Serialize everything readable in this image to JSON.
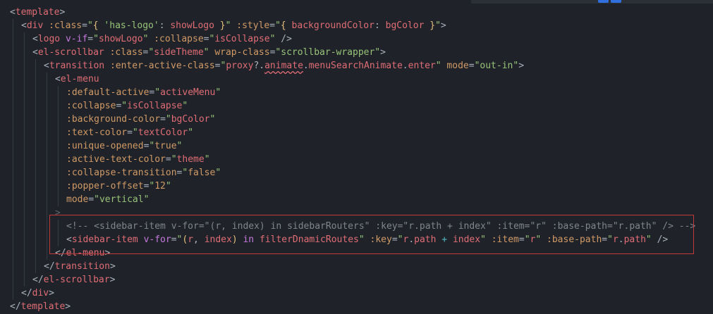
{
  "editor": {
    "language": "vue-template",
    "highlight_color": "#c0393b",
    "lines": [
      {
        "indent": 0,
        "tokens": [
          {
            "k": "punc",
            "t": "<"
          },
          {
            "k": "tag",
            "t": "template"
          },
          {
            "k": "punc",
            "t": ">"
          }
        ]
      },
      {
        "indent": 1,
        "tokens": [
          {
            "k": "punc",
            "t": "<"
          },
          {
            "k": "tag",
            "t": "div"
          },
          {
            "k": "punc",
            "t": " "
          },
          {
            "k": "attr",
            "t": ":class"
          },
          {
            "k": "punc",
            "t": "="
          },
          {
            "k": "str",
            "t": "\""
          },
          {
            "k": "brace",
            "t": "{"
          },
          {
            "k": "str",
            "t": " 'has-logo'"
          },
          {
            "k": "punc",
            "t": ": "
          },
          {
            "k": "var",
            "t": "showLogo"
          },
          {
            "k": "brace",
            "t": " }"
          },
          {
            "k": "str",
            "t": "\""
          },
          {
            "k": "punc",
            "t": " "
          },
          {
            "k": "attr",
            "t": ":style"
          },
          {
            "k": "punc",
            "t": "="
          },
          {
            "k": "str",
            "t": "\""
          },
          {
            "k": "brace",
            "t": "{"
          },
          {
            "k": "var",
            "t": " backgroundColor"
          },
          {
            "k": "punc",
            "t": ": "
          },
          {
            "k": "var",
            "t": "bgColor"
          },
          {
            "k": "brace",
            "t": " }"
          },
          {
            "k": "str",
            "t": "\""
          },
          {
            "k": "punc",
            "t": ">"
          }
        ]
      },
      {
        "indent": 2,
        "tokens": [
          {
            "k": "punc",
            "t": "<"
          },
          {
            "k": "tag",
            "t": "logo"
          },
          {
            "k": "punc",
            "t": " "
          },
          {
            "k": "kw",
            "t": "v-if"
          },
          {
            "k": "punc",
            "t": "="
          },
          {
            "k": "str",
            "t": "\""
          },
          {
            "k": "var",
            "t": "showLogo"
          },
          {
            "k": "str",
            "t": "\""
          },
          {
            "k": "punc",
            "t": " "
          },
          {
            "k": "attr",
            "t": ":collapse"
          },
          {
            "k": "punc",
            "t": "="
          },
          {
            "k": "str",
            "t": "\""
          },
          {
            "k": "var",
            "t": "isCollapse"
          },
          {
            "k": "str",
            "t": "\""
          },
          {
            "k": "punc",
            "t": " />"
          }
        ]
      },
      {
        "indent": 2,
        "tokens": [
          {
            "k": "punc",
            "t": "<"
          },
          {
            "k": "tag",
            "t": "el-scrollbar"
          },
          {
            "k": "punc",
            "t": " "
          },
          {
            "k": "attr",
            "t": ":class"
          },
          {
            "k": "punc",
            "t": "="
          },
          {
            "k": "str",
            "t": "\""
          },
          {
            "k": "var",
            "t": "sideTheme"
          },
          {
            "k": "str",
            "t": "\""
          },
          {
            "k": "punc",
            "t": " "
          },
          {
            "k": "attr",
            "t": "wrap-class"
          },
          {
            "k": "punc",
            "t": "="
          },
          {
            "k": "str",
            "t": "\"scrollbar-wrapper\""
          },
          {
            "k": "punc",
            "t": ">"
          }
        ]
      },
      {
        "indent": 3,
        "tokens": [
          {
            "k": "punc",
            "t": "<"
          },
          {
            "k": "tag",
            "t": "transition"
          },
          {
            "k": "punc",
            "t": " "
          },
          {
            "k": "attr",
            "t": ":enter-active-class"
          },
          {
            "k": "punc",
            "t": "="
          },
          {
            "k": "str",
            "t": "\""
          },
          {
            "k": "var",
            "t": "proxy"
          },
          {
            "k": "punc",
            "t": "?."
          },
          {
            "k": "sq",
            "t": "animate"
          },
          {
            "k": "punc",
            "t": "."
          },
          {
            "k": "var",
            "t": "menuSearchAnimate"
          },
          {
            "k": "punc",
            "t": "."
          },
          {
            "k": "var",
            "t": "enter"
          },
          {
            "k": "str",
            "t": "\""
          },
          {
            "k": "punc",
            "t": " "
          },
          {
            "k": "attr",
            "t": "mode"
          },
          {
            "k": "punc",
            "t": "="
          },
          {
            "k": "str",
            "t": "\"out-in\""
          },
          {
            "k": "punc",
            "t": ">"
          }
        ]
      },
      {
        "indent": 4,
        "tokens": [
          {
            "k": "punc",
            "t": "<"
          },
          {
            "k": "tag",
            "t": "el-menu"
          }
        ]
      },
      {
        "indent": 5,
        "tokens": [
          {
            "k": "attr",
            "t": ":default-active"
          },
          {
            "k": "punc",
            "t": "="
          },
          {
            "k": "str",
            "t": "\""
          },
          {
            "k": "var",
            "t": "activeMenu"
          },
          {
            "k": "str",
            "t": "\""
          }
        ]
      },
      {
        "indent": 5,
        "tokens": [
          {
            "k": "attr",
            "t": ":collapse"
          },
          {
            "k": "punc",
            "t": "="
          },
          {
            "k": "str",
            "t": "\""
          },
          {
            "k": "var",
            "t": "isCollapse"
          },
          {
            "k": "str",
            "t": "\""
          }
        ]
      },
      {
        "indent": 5,
        "tokens": [
          {
            "k": "attr",
            "t": ":background-color"
          },
          {
            "k": "punc",
            "t": "="
          },
          {
            "k": "str",
            "t": "\""
          },
          {
            "k": "var",
            "t": "bgColor"
          },
          {
            "k": "str",
            "t": "\""
          }
        ]
      },
      {
        "indent": 5,
        "tokens": [
          {
            "k": "attr",
            "t": ":text-color"
          },
          {
            "k": "punc",
            "t": "="
          },
          {
            "k": "str",
            "t": "\""
          },
          {
            "k": "var",
            "t": "textColor"
          },
          {
            "k": "str",
            "t": "\""
          }
        ]
      },
      {
        "indent": 5,
        "tokens": [
          {
            "k": "attr",
            "t": ":unique-opened"
          },
          {
            "k": "punc",
            "t": "="
          },
          {
            "k": "str",
            "t": "\""
          },
          {
            "k": "attr",
            "t": "true"
          },
          {
            "k": "str",
            "t": "\""
          }
        ]
      },
      {
        "indent": 5,
        "tokens": [
          {
            "k": "attr",
            "t": ":active-text-color"
          },
          {
            "k": "punc",
            "t": "="
          },
          {
            "k": "str",
            "t": "\""
          },
          {
            "k": "var",
            "t": "theme"
          },
          {
            "k": "str",
            "t": "\""
          }
        ]
      },
      {
        "indent": 5,
        "tokens": [
          {
            "k": "attr",
            "t": ":collapse-transition"
          },
          {
            "k": "punc",
            "t": "="
          },
          {
            "k": "str",
            "t": "\""
          },
          {
            "k": "attr",
            "t": "false"
          },
          {
            "k": "str",
            "t": "\""
          }
        ]
      },
      {
        "indent": 5,
        "tokens": [
          {
            "k": "attr",
            "t": ":popper-offset"
          },
          {
            "k": "punc",
            "t": "="
          },
          {
            "k": "str",
            "t": "\""
          },
          {
            "k": "attr",
            "t": "12"
          },
          {
            "k": "str",
            "t": "\""
          }
        ]
      },
      {
        "indent": 5,
        "tokens": [
          {
            "k": "attr",
            "t": "mode"
          },
          {
            "k": "punc",
            "t": "="
          },
          {
            "k": "str",
            "t": "\"vertical\""
          }
        ]
      },
      {
        "indent": 4,
        "tokens": [
          {
            "k": "dim",
            "t": ">"
          }
        ]
      },
      {
        "indent": 5,
        "tokens": [
          {
            "k": "comment",
            "t": "<!-- <sidebar-item v-for=\"(r, index) in sidebarRouters\" :key=\"r.path + index\" :item=\"r\" :base-path=\"r.path\" /> -->"
          }
        ]
      },
      {
        "indent": 5,
        "tokens": [
          {
            "k": "punc",
            "t": "<"
          },
          {
            "k": "tag",
            "t": "sidebar-item"
          },
          {
            "k": "punc",
            "t": " "
          },
          {
            "k": "kw",
            "t": "v-for"
          },
          {
            "k": "punc",
            "t": "="
          },
          {
            "k": "str",
            "t": "\""
          },
          {
            "k": "brace",
            "t": "("
          },
          {
            "k": "var",
            "t": "r"
          },
          {
            "k": "punc",
            "t": ", "
          },
          {
            "k": "var",
            "t": "index"
          },
          {
            "k": "brace",
            "t": ")"
          },
          {
            "k": "punc",
            "t": " "
          },
          {
            "k": "kw",
            "t": "in"
          },
          {
            "k": "punc",
            "t": " "
          },
          {
            "k": "var",
            "t": "filterDnamicRoutes"
          },
          {
            "k": "str",
            "t": "\""
          },
          {
            "k": "punc",
            "t": " "
          },
          {
            "k": "attr",
            "t": ":key"
          },
          {
            "k": "punc",
            "t": "="
          },
          {
            "k": "str",
            "t": "\""
          },
          {
            "k": "var",
            "t": "r"
          },
          {
            "k": "punc",
            "t": "."
          },
          {
            "k": "var",
            "t": "path"
          },
          {
            "k": "op",
            "t": " + "
          },
          {
            "k": "var",
            "t": "index"
          },
          {
            "k": "str",
            "t": "\""
          },
          {
            "k": "punc",
            "t": " "
          },
          {
            "k": "attr",
            "t": ":item"
          },
          {
            "k": "punc",
            "t": "="
          },
          {
            "k": "str",
            "t": "\""
          },
          {
            "k": "var",
            "t": "r"
          },
          {
            "k": "str",
            "t": "\""
          },
          {
            "k": "punc",
            "t": " "
          },
          {
            "k": "attr",
            "t": ":base-path"
          },
          {
            "k": "punc",
            "t": "="
          },
          {
            "k": "str",
            "t": "\""
          },
          {
            "k": "var",
            "t": "r"
          },
          {
            "k": "punc",
            "t": "."
          },
          {
            "k": "var",
            "t": "path"
          },
          {
            "k": "str",
            "t": "\""
          },
          {
            "k": "punc",
            "t": " />"
          }
        ]
      },
      {
        "indent": 4,
        "tokens": [
          {
            "k": "punc",
            "t": "</"
          },
          {
            "k": "tag",
            "t": "el-menu"
          },
          {
            "k": "punc",
            "t": ">"
          }
        ]
      },
      {
        "indent": 3,
        "tokens": [
          {
            "k": "punc",
            "t": "</"
          },
          {
            "k": "tag",
            "t": "transition"
          },
          {
            "k": "punc",
            "t": ">"
          }
        ]
      },
      {
        "indent": 2,
        "tokens": [
          {
            "k": "punc",
            "t": "</"
          },
          {
            "k": "tag",
            "t": "el-scrollbar"
          },
          {
            "k": "punc",
            "t": ">"
          }
        ]
      },
      {
        "indent": 1,
        "tokens": [
          {
            "k": "punc",
            "t": "</"
          },
          {
            "k": "tag",
            "t": "div"
          },
          {
            "k": "punc",
            "t": ">"
          }
        ]
      },
      {
        "indent": 0,
        "tokens": [
          {
            "k": "punc",
            "t": "</"
          },
          {
            "k": "tag",
            "t": "template"
          },
          {
            "k": "punc",
            "t": ">"
          }
        ]
      }
    ]
  }
}
